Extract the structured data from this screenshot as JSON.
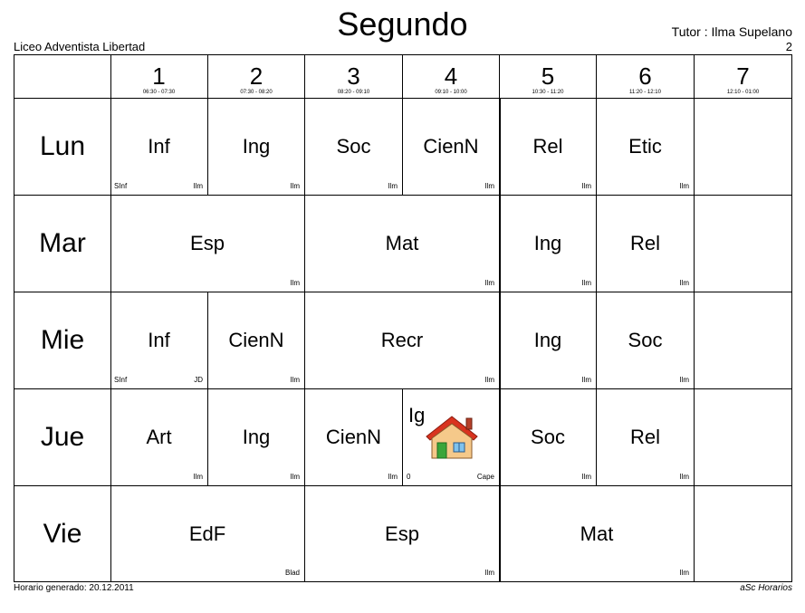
{
  "header": {
    "title": "Segundo",
    "school": "Liceo Adventista Libertad",
    "tutor": "Tutor : Ilma Supelano",
    "class_number": "2"
  },
  "periods": [
    {
      "num": "1",
      "time": "06:30 - 07:30"
    },
    {
      "num": "2",
      "time": "07:30 - 08:20"
    },
    {
      "num": "3",
      "time": "08:20 - 09:10"
    },
    {
      "num": "4",
      "time": "09:10 - 10:00"
    },
    {
      "num": "5",
      "time": "10:30 - 11:20"
    },
    {
      "num": "6",
      "time": "11:20 - 12:10"
    },
    {
      "num": "7",
      "time": "12:10 - 01:00"
    }
  ],
  "days": [
    "Lun",
    "Mar",
    "Mie",
    "Jue",
    "Vie"
  ],
  "lessons": {
    "lun": [
      {
        "subject": "Inf",
        "room": "SInf",
        "teacher": "Ilm"
      },
      {
        "subject": "Ing",
        "room": "",
        "teacher": "Ilm"
      },
      {
        "subject": "Soc",
        "room": "",
        "teacher": "Ilm"
      },
      {
        "subject": "CienN",
        "room": "",
        "teacher": "Ilm"
      },
      {
        "subject": "Rel",
        "room": "",
        "teacher": "Ilm"
      },
      {
        "subject": "Etic",
        "room": "",
        "teacher": "Ilm"
      }
    ],
    "mar": [
      {
        "subject": "Esp",
        "room": "",
        "teacher": "Ilm"
      },
      {
        "subject": "Mat",
        "room": "",
        "teacher": "Ilm"
      },
      {
        "subject": "Ing",
        "room": "",
        "teacher": "Ilm"
      },
      {
        "subject": "Rel",
        "room": "",
        "teacher": "Ilm"
      }
    ],
    "mie": [
      {
        "subject": "Inf",
        "room": "SInf",
        "teacher": "JD"
      },
      {
        "subject": "CienN",
        "room": "",
        "teacher": "Ilm"
      },
      {
        "subject": "Recr",
        "room": "",
        "teacher": "Ilm"
      },
      {
        "subject": "Ing",
        "room": "",
        "teacher": "Ilm"
      },
      {
        "subject": "Soc",
        "room": "",
        "teacher": "Ilm"
      }
    ],
    "jue": [
      {
        "subject": "Art",
        "room": "",
        "teacher": "Ilm"
      },
      {
        "subject": "Ing",
        "room": "",
        "teacher": "Ilm"
      },
      {
        "subject": "CienN",
        "room": "",
        "teacher": "Ilm"
      },
      {
        "subject": "Ig",
        "room": "0",
        "teacher": "Cape",
        "icon": "house-icon"
      },
      {
        "subject": "Soc",
        "room": "",
        "teacher": "Ilm"
      },
      {
        "subject": "Rel",
        "room": "",
        "teacher": "Ilm"
      }
    ],
    "vie": [
      {
        "subject": "EdF",
        "room": "",
        "teacher": "Blad"
      },
      {
        "subject": "Esp",
        "room": "",
        "teacher": "Ilm"
      },
      {
        "subject": "Mat",
        "room": "",
        "teacher": "Ilm"
      }
    ]
  },
  "footer": {
    "generated": "Horario generado: 20.12.2011",
    "software": "aSc Horarios"
  },
  "colors": {
    "grid_line": "#000000",
    "house_roof": "#d9331f",
    "house_wall": "#f5c98a",
    "house_door": "#3aa53a"
  }
}
